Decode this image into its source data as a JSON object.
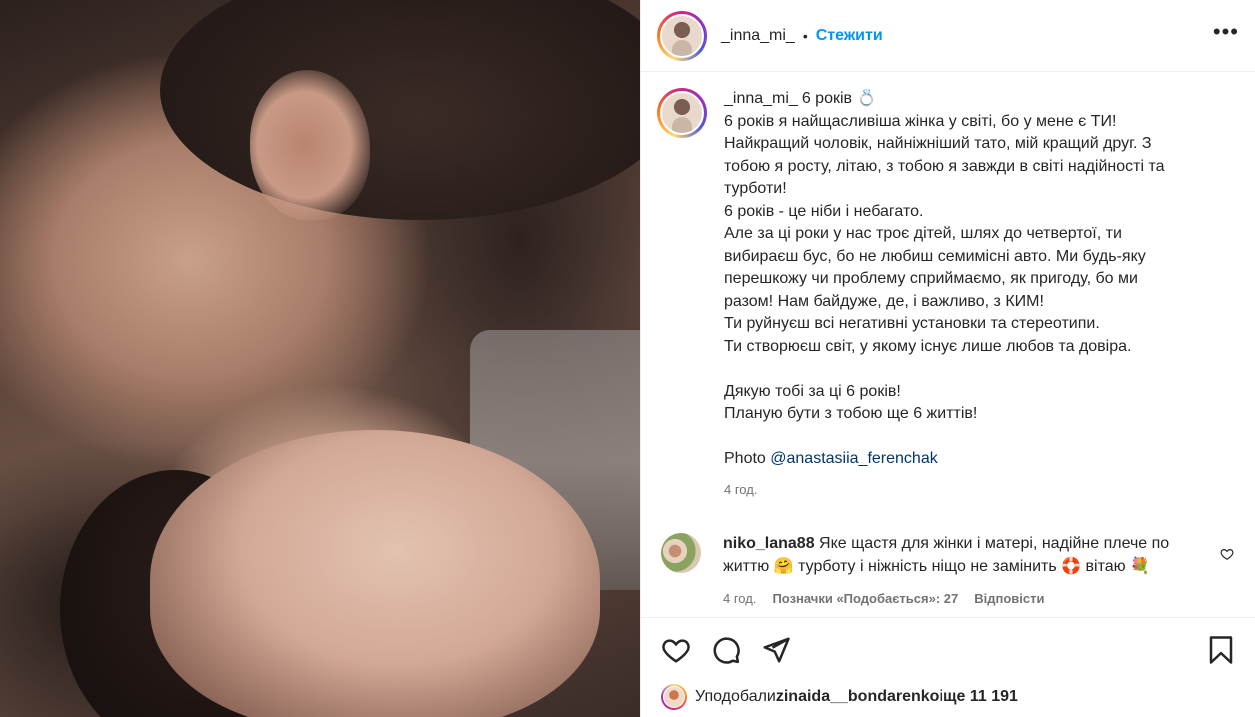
{
  "post": {
    "username": "_inna_mi_",
    "follow_label": "Стежити",
    "header_dot": "•",
    "more_label": "•••",
    "caption_username": "_inna_mi_",
    "caption_lines": [
      "6 років 💍",
      "6 років я найщасливіша жінка у світі, бо у мене є ТИ!",
      "Найкращий чоловік, найніжніший тато, мій кращий друг. З",
      "тобою я росту, літаю, з тобою я завжди в світі надійності та",
      "турботи!",
      "6 років - це ніби і небагато.",
      "Але за ці роки у нас троє дітей, шлях до четвертої, ти",
      "вибираєш бус, бо не любиш семимісні авто. Ми будь-яку",
      "перешкожу чи проблему сприймаємо, як пригоду, бо ми",
      "разом! Нам байдуже, де, і важливо, з КИМ!",
      "Ти руйнуєш всі негативні установки та стереотипи.",
      "Ти створюєш світ, у якому існує лише любов та довіра.",
      "",
      "Дякую тобі за ці 6 років!",
      "Планую бути з тобою ще 6 життів!",
      ""
    ],
    "photo_prefix": "Photo ",
    "photo_mention": "@anastasiia_ferenchak",
    "time": "4 год."
  },
  "comment": {
    "username": "niko_lana88",
    "text_line1": " Яке щастя для жінки і матері, надійне плече по",
    "text_line2": "життю 🤗 турботу і ніжність ніщо не замінить 🛟 вітаю 💐",
    "time": "4 год.",
    "likes_label": "Позначки «Подобається»: 27",
    "reply_label": "Відповісти"
  },
  "likes": {
    "prefix": "Уподобали ",
    "user": "zinaida__bondarenko",
    "middle": " і ",
    "more": "ще 11 191"
  }
}
